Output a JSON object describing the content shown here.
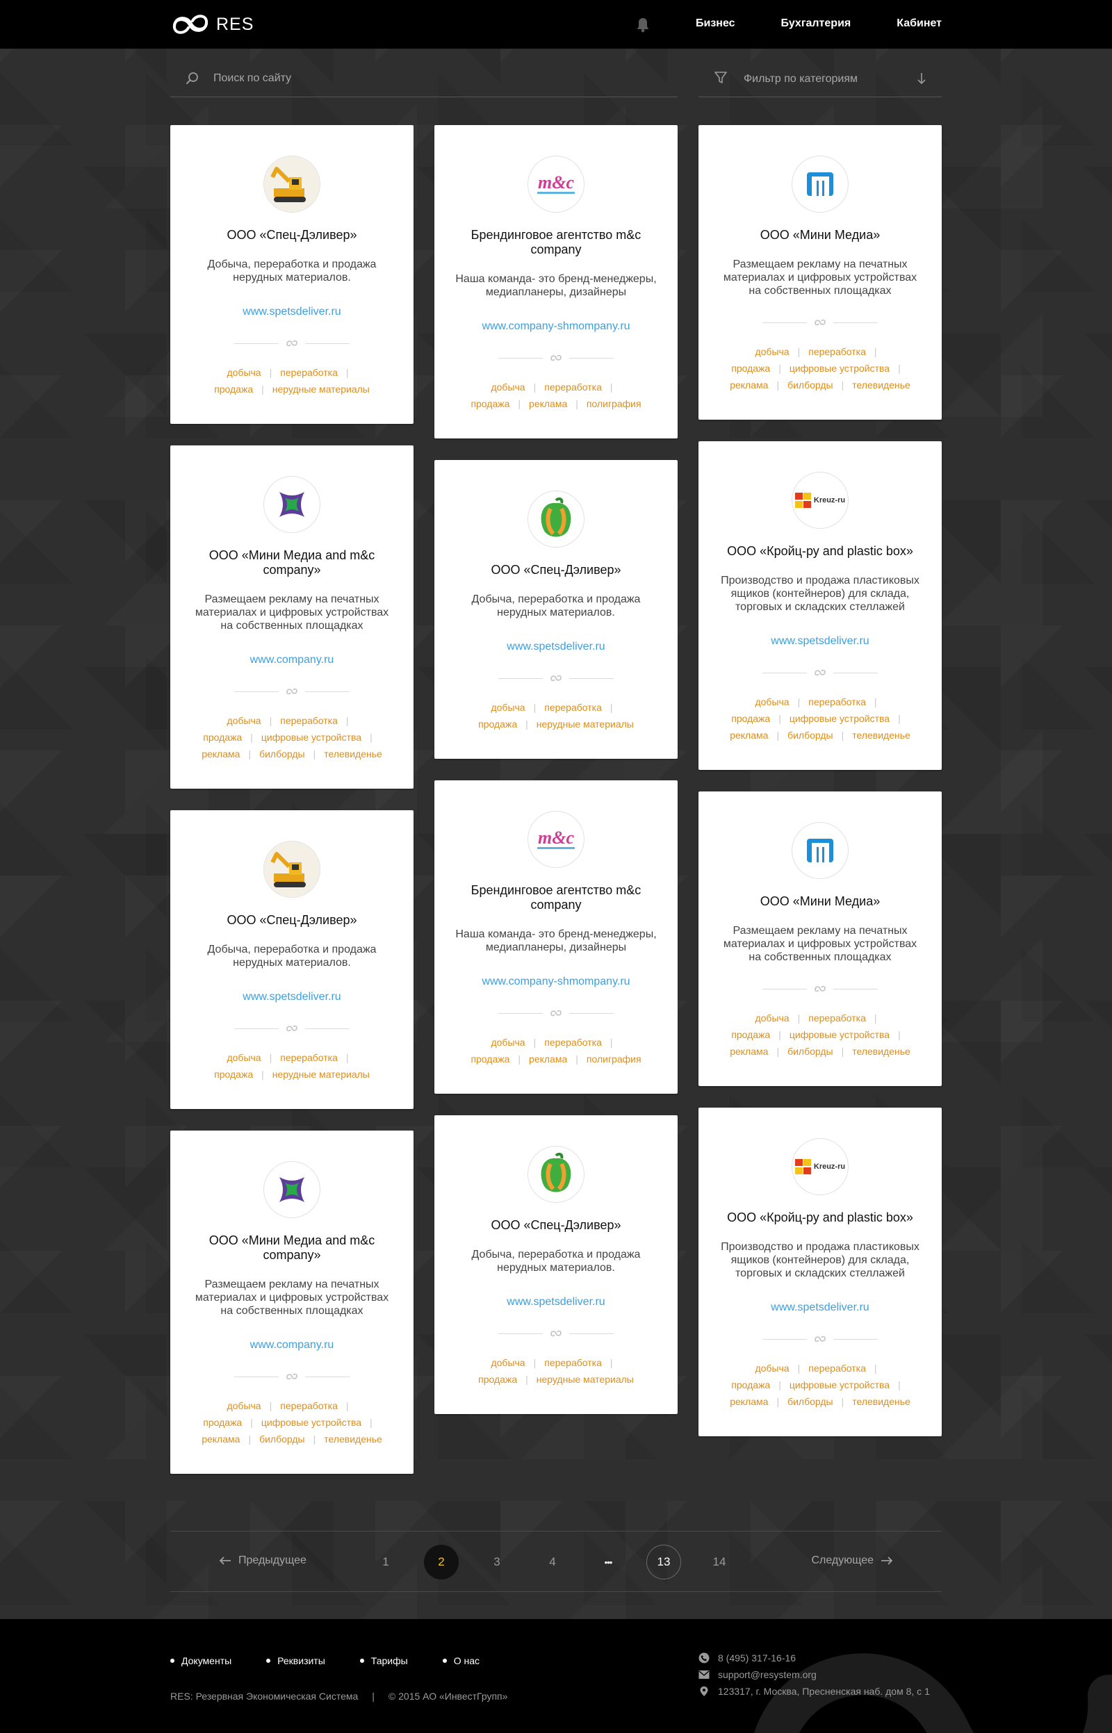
{
  "header": {
    "logo_text": "RES",
    "nav": [
      "Бизнес",
      "Бухгалтерия",
      "Кабинет"
    ]
  },
  "search": {
    "placeholder": "Поиск по сайту"
  },
  "filter": {
    "label": "Фильтр по категориям"
  },
  "columns": [
    [
      {
        "logo": "excavator-logo",
        "title": "ООО «Спец-Дэливер»",
        "desc": "Добыча, переработка и продажа нерудных материалов.",
        "site": "www.spetsdeliver.ru",
        "tags": [
          "добыча",
          "переработка",
          "продажа",
          "нерудные материалы"
        ]
      },
      {
        "logo": "cross-logo",
        "title": "ООО «Мини Медиа and m&c company»",
        "desc": "Размещаем рекламу на печатных материалах и цифровых устройствах на собственных площадках",
        "site": "www.company.ru",
        "tags": [
          "добыча",
          "переработка",
          "продажа",
          "цифровые устройства",
          "реклама",
          "билборды",
          "телевиденье"
        ]
      },
      {
        "logo": "excavator-logo",
        "title": "ООО «Спец-Дэливер»",
        "desc": "Добыча, переработка и продажа нерудных материалов.",
        "site": "www.spetsdeliver.ru",
        "tags": [
          "добыча",
          "переработка",
          "продажа",
          "нерудные материалы"
        ]
      },
      {
        "logo": "cross-logo",
        "title": "ООО «Мини Медиа and m&c company»",
        "desc": "Размещаем рекламу на печатных материалах и цифровых устройствах на собственных площадках",
        "site": "www.company.ru",
        "tags": [
          "добыча",
          "переработка",
          "продажа",
          "цифровые устройства",
          "реклама",
          "билборды",
          "телевиденье"
        ]
      }
    ],
    [
      {
        "logo": "mc-logo",
        "logo_text": "m&c",
        "title": "Брендинговое агентство m&c company",
        "desc": "Наша команда- это бренд-менеджеры, медиапланеры, дизайнеры",
        "site": "www.company-shmompany.ru",
        "tags": [
          "добыча",
          "переработка",
          "продажа",
          "реклама",
          "полиграфия"
        ]
      },
      {
        "logo": "pepper-logo",
        "title": "ООО «Спец-Дэливер»",
        "desc": "Добыча, переработка и продажа нерудных материалов.",
        "site": "www.spetsdeliver.ru",
        "tags": [
          "добыча",
          "переработка",
          "продажа",
          "нерудные материалы"
        ]
      },
      {
        "logo": "mc-logo",
        "logo_text": "m&c",
        "title": "Брендинговое агентство m&c company",
        "desc": "Наша команда- это бренд-менеджеры, медиапланеры, дизайнеры",
        "site": "www.company-shmompany.ru",
        "tags": [
          "добыча",
          "переработка",
          "продажа",
          "реклама",
          "полиграфия"
        ]
      },
      {
        "logo": "pepper-logo",
        "title": "ООО «Спец-Дэливер»",
        "desc": "Добыча, переработка и продажа нерудных материалов.",
        "site": "www.spetsdeliver.ru",
        "tags": [
          "добыча",
          "переработка",
          "продажа",
          "нерудные материалы"
        ]
      }
    ],
    [
      {
        "logo": "m-logo",
        "title": "ООО «Мини Медиа»",
        "desc": "Размещаем рекламу на печатных материалах и цифровых устройствах на собственных площадках",
        "site": "",
        "tags": [
          "добыча",
          "переработка",
          "продажа",
          "цифровые устройства",
          "реклама",
          "билборды",
          "телевиденье"
        ]
      },
      {
        "logo": "kreuz-logo",
        "logo_text": "Kreuz-ru",
        "title": "ООО «Кройц-ру and plastic box»",
        "desc": "Производство и продажа пластиковых ящиков (контейнеров) для склада, торговых и складских стеллажей",
        "site": "www.spetsdeliver.ru",
        "tags": [
          "добыча",
          "переработка",
          "продажа",
          "цифровые устройства",
          "реклама",
          "билборды",
          "телевиденье"
        ]
      },
      {
        "logo": "m-logo",
        "title": "ООО «Мини Медиа»",
        "desc": "Размещаем рекламу на печатных материалах и цифровых устройствах на собственных площадках",
        "site": "",
        "tags": [
          "добыча",
          "переработка",
          "продажа",
          "цифровые устройства",
          "реклама",
          "билборды",
          "телевиденье"
        ]
      },
      {
        "logo": "kreuz-logo",
        "logo_text": "Kreuz-ru",
        "title": "ООО «Кройц-ру and plastic box»",
        "desc": "Производство и продажа пластиковых ящиков (контейнеров) для склада, торговых и складских стеллажей",
        "site": "www.spetsdeliver.ru",
        "tags": [
          "добыча",
          "переработка",
          "продажа",
          "цифровые устройства",
          "реклама",
          "билборды",
          "телевиденье"
        ]
      }
    ]
  ],
  "pagination": {
    "prev": "Предыдущее",
    "next": "Следующее",
    "pages": [
      "1",
      "2",
      "3",
      "4",
      "•••",
      "13",
      "14"
    ],
    "current": "2"
  },
  "footer": {
    "links": [
      "Документы",
      "Реквизиты",
      "Тарифы",
      "О нас"
    ],
    "brand": "RES: Резервная Экономическая Система",
    "copyright": "© 2015 АО «ИнвестГрупп»",
    "phone": "8 (495) 317-16-16",
    "email": "support@resystem.org",
    "address": "123317, г. Москва, Пресненская наб. дом 8, с 1"
  },
  "colors": {
    "tag": "#e08d16",
    "link": "#3ba0e0",
    "active_page": "#f5c518"
  }
}
